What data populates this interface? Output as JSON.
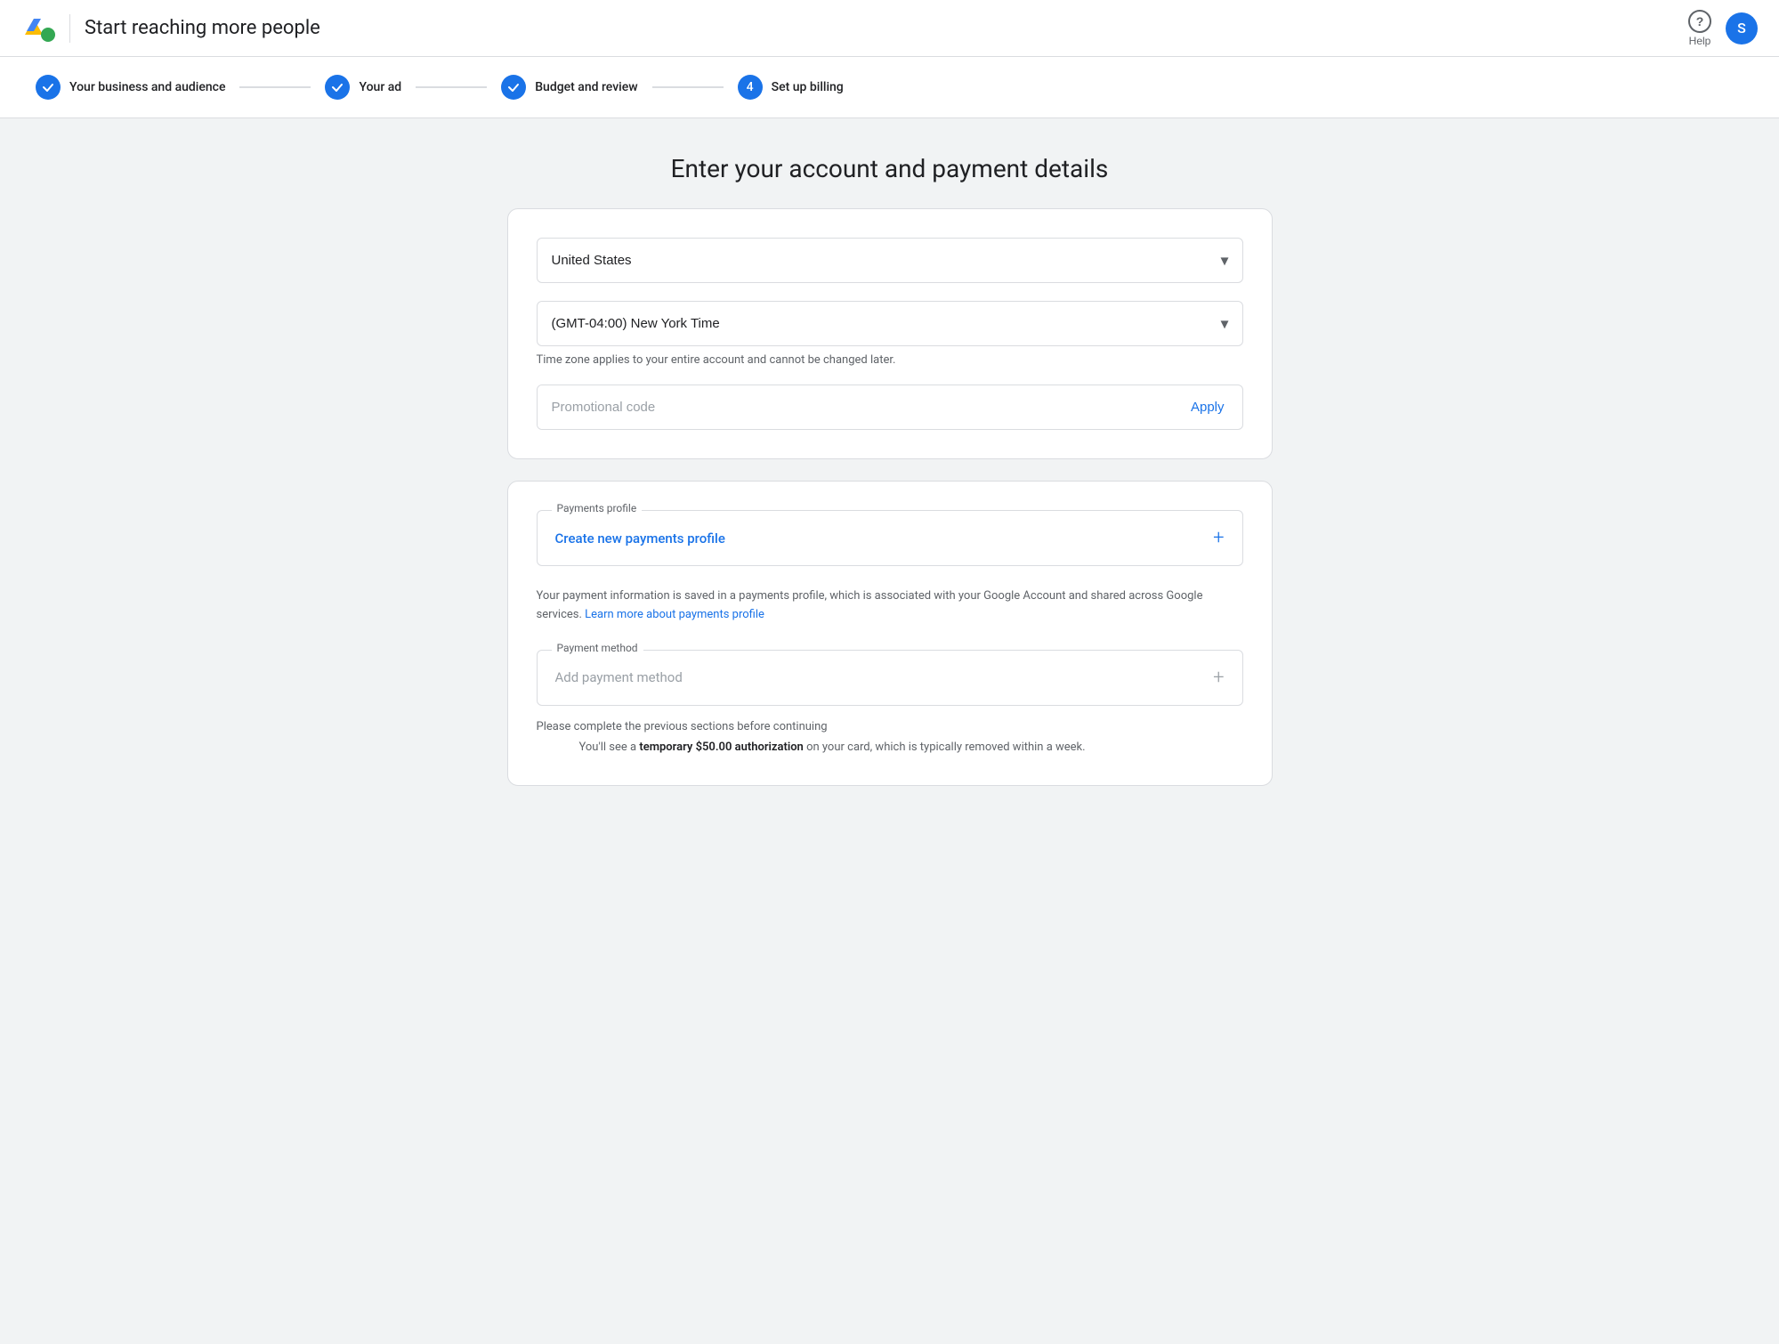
{
  "header": {
    "title": "Start reaching more people",
    "help_label": "Help",
    "avatar_initial": "S"
  },
  "steps": [
    {
      "id": 1,
      "label": "Your business and audience",
      "status": "complete"
    },
    {
      "id": 2,
      "label": "Your ad",
      "status": "complete"
    },
    {
      "id": 3,
      "label": "Budget and review",
      "status": "complete"
    },
    {
      "id": 4,
      "label": "Set up billing",
      "status": "active"
    }
  ],
  "main": {
    "page_title": "Enter your account and payment details"
  },
  "form_card": {
    "country_label": "United States",
    "timezone_label": "(GMT-04:00) New York Time",
    "timezone_hint": "Time zone applies to your entire account and cannot be changed later.",
    "promo_placeholder": "Promotional code",
    "apply_label": "Apply"
  },
  "payments_card": {
    "profile_legend": "Payments profile",
    "profile_link": "Create new payments profile",
    "profile_info": "Your payment information is saved in a payments profile, which is associated with your Google Account and shared across Google services.",
    "profile_learn_more": "Learn more about payments profile",
    "payment_legend": "Payment method",
    "payment_placeholder": "Add payment method",
    "payment_hint": "Please complete the previous sections before continuing",
    "payment_auth_text": "You'll see a",
    "payment_auth_bold": "temporary $50.00 authorization",
    "payment_auth_suffix": "on your card, which is typically removed within a week."
  }
}
